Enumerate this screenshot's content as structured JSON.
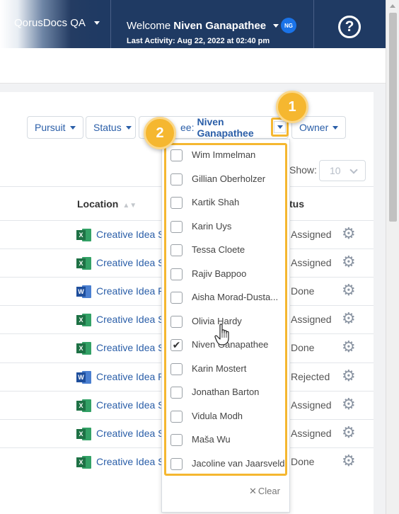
{
  "topbar": {
    "workspace": "QorusDocs QA",
    "welcome_label": "Welcome",
    "user_name": "Niven Ganapathee",
    "avatar_initials": "NG",
    "last_activity": "Last Activity: Aug 22, 2022 at 02:40 pm",
    "help_icon": "?"
  },
  "filters": {
    "pursuit": "Pursuit",
    "status": "Status",
    "assignee_prefix": "ee:",
    "assignee_value": "Niven Ganapathee",
    "owner": "Owner"
  },
  "show": {
    "label": "Show:",
    "value": "10"
  },
  "columns": {
    "location": "Location",
    "status": "tus"
  },
  "rows": [
    {
      "type": "x",
      "tag": "X",
      "location": "Creative Idea Se",
      "status": "Assigned"
    },
    {
      "type": "x",
      "tag": "X",
      "location": "Creative Idea Se",
      "status": "Assigned"
    },
    {
      "type": "w",
      "tag": "W",
      "location": "Creative Idea RI",
      "status": "Done"
    },
    {
      "type": "x",
      "tag": "X",
      "location": "Creative Idea Se",
      "status": "Assigned"
    },
    {
      "type": "x",
      "tag": "X",
      "location": "Creative Idea Se",
      "status": "Done"
    },
    {
      "type": "w",
      "tag": "W",
      "location": "Creative Idea RI",
      "status": "Rejected"
    },
    {
      "type": "x",
      "tag": "X",
      "location": "Creative Idea Se",
      "status": "Assigned"
    },
    {
      "type": "x",
      "tag": "X",
      "location": "Creative Idea Se",
      "status": "Assigned"
    },
    {
      "type": "x",
      "tag": "X",
      "location": "Creative Idea Se",
      "status": "Done"
    }
  ],
  "dropdown": {
    "items": [
      {
        "label": "Wim Immelman",
        "checked": false
      },
      {
        "label": "Gillian Oberholzer",
        "checked": false
      },
      {
        "label": "Kartik Shah",
        "checked": false
      },
      {
        "label": "Karin Uys",
        "checked": false
      },
      {
        "label": "Tessa Cloete",
        "checked": false
      },
      {
        "label": "Rajiv Bappoo",
        "checked": false
      },
      {
        "label": "Aisha Morad-Dusta...",
        "checked": false
      },
      {
        "label": "Olivia Hardy",
        "checked": false
      },
      {
        "label": "Niven Ganapathee",
        "checked": true
      },
      {
        "label": "Karin Mostert",
        "checked": false
      },
      {
        "label": "Jonathan Barton",
        "checked": false
      },
      {
        "label": "Vidula Modh",
        "checked": false
      },
      {
        "label": "Maša Wu",
        "checked": false
      },
      {
        "label": "Jacoline van Jaarsveld",
        "checked": false
      }
    ],
    "clear_label": "Clear"
  },
  "callouts": {
    "step1": "1",
    "step2": "2"
  },
  "colors": {
    "accent": "#f5b730",
    "nav": "#1f3a63",
    "link": "#2a5ea8"
  }
}
